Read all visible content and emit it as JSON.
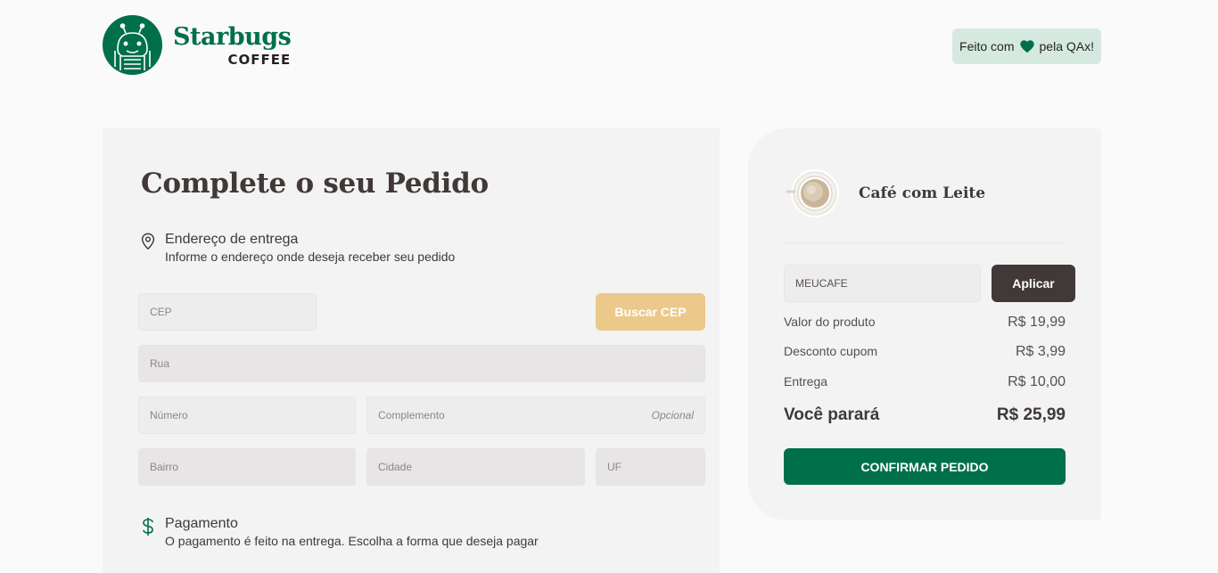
{
  "header": {
    "brand": "Starbugs",
    "brand_sub": "COFFEE",
    "badge_before": "Feito com",
    "badge_after": "pela QAx!"
  },
  "form": {
    "title": "Complete o seu Pedido",
    "address": {
      "heading": "Endereço de entrega",
      "subheading": "Informe o endereço onde deseja receber seu pedido"
    },
    "fields": {
      "cep": "CEP",
      "rua": "Rua",
      "numero": "Número",
      "complemento": "Complemento",
      "opcional": "Opcional",
      "bairro": "Bairro",
      "cidade": "Cidade",
      "uf": "UF"
    },
    "buscar_cep": "Buscar CEP",
    "payment": {
      "heading": "Pagamento",
      "subheading": "O pagamento é feito na entrega. Escolha a forma que deseja pagar"
    }
  },
  "summary": {
    "item_name": "Café com Leite",
    "coupon_value": "MEUCAFE",
    "apply_label": "Aplicar",
    "rows": [
      {
        "label": "Valor do produto",
        "value": "R$ 19,99"
      },
      {
        "label": "Desconto cupom",
        "value": "R$ 3,99"
      },
      {
        "label": "Entrega",
        "value": "R$ 10,00"
      }
    ],
    "total_label": "Você parará",
    "total_value": "R$ 25,99",
    "confirm_label": "CONFIRMAR PEDIDO"
  },
  "colors": {
    "brand_green": "#00704a",
    "accent_yellow": "#ebc98a",
    "dark_brown": "#403937"
  },
  "icons": {
    "logo": "starbugs-robot-logo",
    "heart": "heart-icon",
    "address": "map-pin-icon",
    "payment": "dollar-sign-icon",
    "item": "coffee-cup-icon"
  }
}
